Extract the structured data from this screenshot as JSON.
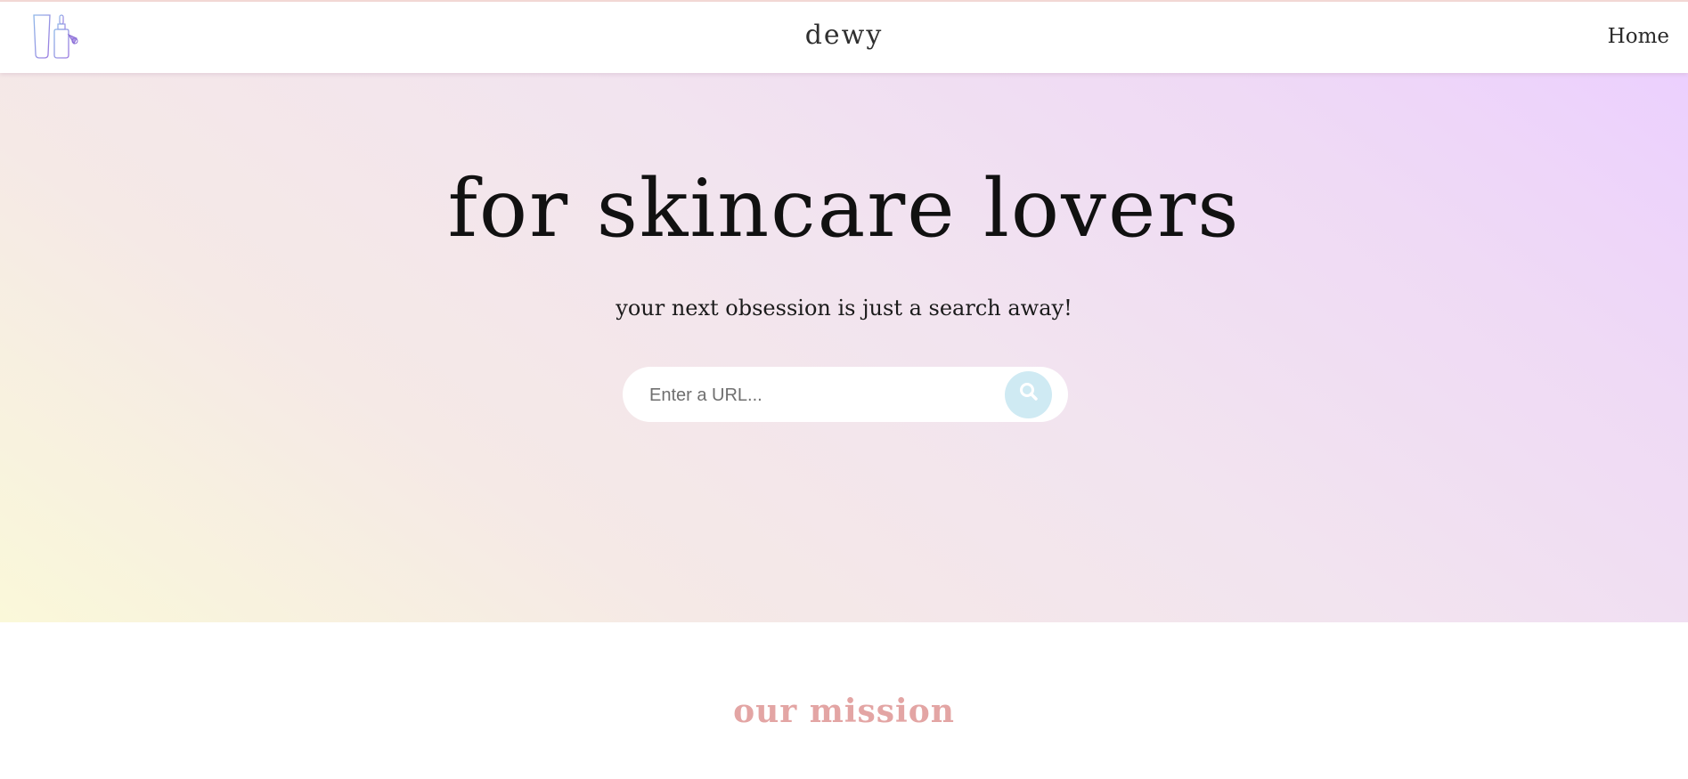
{
  "navbar": {
    "brand": "dewy",
    "links": [
      "Home"
    ],
    "logo_icon": "skincare-bottles-icon"
  },
  "hero": {
    "title": "for skincare lovers",
    "subtitle": "your next obsession is just a search away!",
    "search": {
      "placeholder": "Enter a URL...",
      "value": "",
      "button_icon": "search-icon"
    }
  },
  "mission": {
    "title": "our mission"
  },
  "colors": {
    "accent_pink": "#e3a5a4",
    "search_button": "#cfeaf3",
    "gradient_start": "#faf8d9",
    "gradient_end": "#ecd0fe"
  }
}
